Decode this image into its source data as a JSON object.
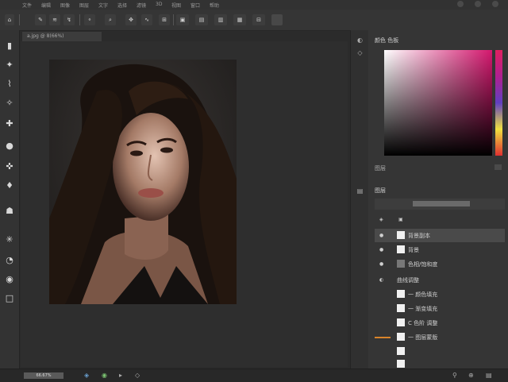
{
  "menubar": {
    "items": [
      "文件",
      "编辑",
      "图像",
      "图层",
      "文字",
      "选择",
      "滤镜",
      "3D",
      "视图",
      "窗口",
      "帮助"
    ]
  },
  "options_bar": {
    "buttons": [
      "⌂",
      "✎",
      "≋",
      "↯",
      "⚬",
      "⌕",
      "✥",
      "∿",
      "⊞",
      "⊟",
      "▣",
      "▤",
      "▥",
      "▦"
    ]
  },
  "document_tab": {
    "label": "a.jpg @ 8(66%)"
  },
  "color_panel": {
    "title": "颜色 色板",
    "footer": "图层"
  },
  "layers_panel": {
    "title": "图层",
    "layers": [
      {
        "name": "背景副本",
        "selected": true
      },
      {
        "name": "背景",
        "selected": false
      },
      {
        "name": "色相/饱和度",
        "selected": false
      },
      {
        "name": "曲线调整",
        "selected": false
      },
      {
        "name": "一 颜色填充",
        "selected": false
      },
      {
        "name": "一 渐变填充",
        "selected": false
      },
      {
        "name": "C 色阶 调整",
        "selected": false
      },
      {
        "name": "一 图层蒙版",
        "selected": false
      },
      {
        "name": "",
        "selected": false
      },
      {
        "name": "",
        "selected": false
      }
    ]
  },
  "status_bar": {
    "zoom": "66.67%"
  },
  "colors": {
    "accent_orange": "#d9832a",
    "picker_hue": "#d4176e"
  }
}
